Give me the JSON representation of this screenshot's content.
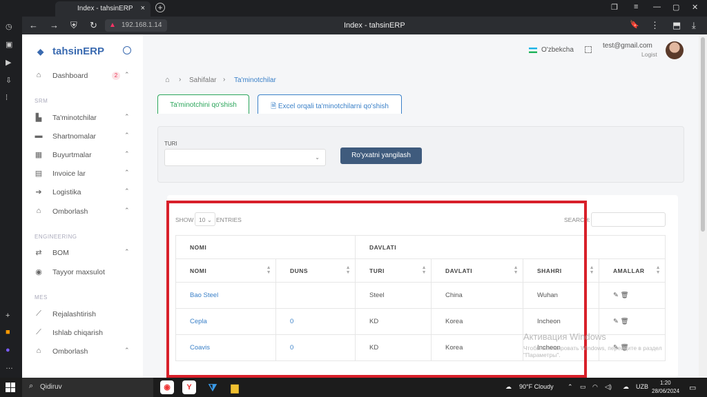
{
  "browser": {
    "tab_title": "Index - tahsinERP",
    "tab_close": "×",
    "new_tab": "+",
    "url": "192.168.1.14",
    "page_title": "Index - tahsinERP"
  },
  "sidebar": {
    "brand": "tahsinERP",
    "sections": [
      "SRM",
      "ENGINEERING",
      "MES"
    ],
    "dashboard": {
      "label": "Dashboard",
      "badge": "2"
    },
    "srm_items": [
      {
        "label": "Ta'minotchilar",
        "icon": "factory-icon"
      },
      {
        "label": "Shartnomalar",
        "icon": "contract-icon"
      },
      {
        "label": "Buyurtmalar",
        "icon": "orders-icon"
      },
      {
        "label": "Invoice lar",
        "icon": "invoice-icon"
      },
      {
        "label": "Logistika",
        "icon": "logistics-icon"
      },
      {
        "label": "Omborlash",
        "icon": "warehouse-icon"
      }
    ],
    "eng_items": [
      {
        "label": "BOM",
        "icon": "bom-icon"
      },
      {
        "label": "Tayyor maxsulot",
        "icon": "product-icon"
      }
    ],
    "mes_items": [
      {
        "label": "Rejalashtirish",
        "icon": "chart-icon"
      },
      {
        "label": "Ishlab chiqarish",
        "icon": "chart-icon"
      },
      {
        "label": "Omborlash",
        "icon": "warehouse-icon"
      }
    ]
  },
  "header": {
    "language": "O'zbekcha",
    "email": "test@gmail.com",
    "role": "Logist"
  },
  "breadcrumb": {
    "level1": "Sahifalar",
    "level2": "Ta'minotchilar"
  },
  "tabs": {
    "add_supplier": "Ta'minotchini qo'shish",
    "add_excel": "Excel orqali ta'minotchilarni qo'shish"
  },
  "filter": {
    "turi_label": "TURI",
    "refresh_button": "Ro'yxatni yangilash"
  },
  "table": {
    "show_label": "SHOW",
    "show_value": "10",
    "entries_label": "ENTRIES",
    "search_label": "SEARCH:",
    "group_headers": [
      "NOMI",
      "DAVLATI"
    ],
    "columns": [
      "NOMI",
      "DUNS",
      "TURI",
      "DAVLATI",
      "SHAHRI",
      "AMALLAR"
    ],
    "rows": [
      {
        "nomi": "Bao Steel",
        "duns": "",
        "turi": "Steel",
        "davlati": "China",
        "shahri": "Wuhan"
      },
      {
        "nomi": "Cepla",
        "duns": "0",
        "turi": "KD",
        "davlati": "Korea",
        "shahri": "Incheon"
      },
      {
        "nomi": "Coavis",
        "duns": "0",
        "turi": "KD",
        "davlati": "Korea",
        "shahri": "Incheon"
      }
    ]
  },
  "watermark": {
    "title": "Активация Windows",
    "text": "Чтобы активировать Windows, перейдите в раздел \"Параметры\"."
  },
  "taskbar": {
    "search_placeholder": "Qidiruv",
    "weather": "90°F Cloudy",
    "lang": "UZB",
    "time": "1:20",
    "date": "28/06/2024",
    "notif_count": "2"
  }
}
